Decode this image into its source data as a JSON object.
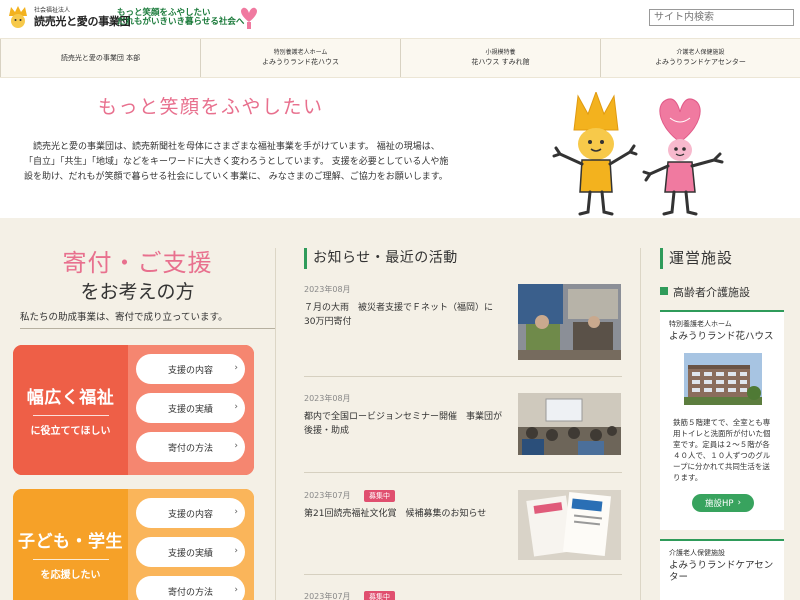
{
  "header": {
    "logo_sub": "社会福祉法人",
    "logo_main": "読売光と愛の事業団",
    "tagline_1": "もっと笑顔をふやしたい",
    "tagline_2": "だれもがいきいき暮らせる社会へ",
    "search_placeholder": "サイト内検索"
  },
  "nav": [
    {
      "sub": "",
      "label": "読売光と愛の事業団 本部"
    },
    {
      "sub": "特別養護老人ホーム",
      "label": "よみうりランド花ハウス"
    },
    {
      "sub": "小規模特養",
      "label": "花ハウス すみれ館"
    },
    {
      "sub": "介護老人保健施設",
      "label": "よみうりランドケアセンター"
    }
  ],
  "hero": {
    "title": "もっと笑顔をふやしたい",
    "text": "読売光と愛の事業団は、読売新聞社を母体にさまざまな福祉事業を手がけています。 福祉の現場は、「自立」「共生」「地域」などをキーワードに大きく変わろうとしています。 支援を必要としている人や施設を助け、だれもが笑顔で暮らせる社会にしていく事業に、 みなさまのご理解、ご協力をお願いします。"
  },
  "donate": {
    "title": "寄付・ご支援",
    "subtitle": "をお考えの方",
    "note": "私たちの助成事業は、寄付で成り立っています。",
    "cards": [
      {
        "big": "幅広く福祉",
        "small": "に役立ててほしい",
        "buttons": [
          "支援の内容",
          "支援の実績",
          "寄付の方法"
        ]
      },
      {
        "big": "子ども・学生",
        "small": "を応援したい",
        "buttons": [
          "支援の内容",
          "支援の実績",
          "寄付の方法"
        ]
      }
    ]
  },
  "news": {
    "heading": "お知らせ・最近の活動",
    "items": [
      {
        "date": "2023年08月",
        "badge": "",
        "text": "７月の大雨　被災者支援でＦネット（福岡）に30万円寄付"
      },
      {
        "date": "2023年08月",
        "badge": "",
        "text": "都内で全国ロービジョンセミナー開催　事業団が後援・助成"
      },
      {
        "date": "2023年07月",
        "badge": "募集中",
        "text": "第21回読売福祉文化賞　候補募集のお知らせ"
      },
      {
        "date": "2023年07月",
        "badge": "募集中",
        "text": ""
      }
    ]
  },
  "facilities": {
    "heading": "運営施設",
    "category": "高齢者介護施設",
    "cards": [
      {
        "label": "特別養護老人ホーム",
        "name": "よみうりランド花ハウス",
        "desc": "鉄筋５階建てで、全室とも専用トイレと洗面所が付いた個室です。定員は２～５階が各４０人で、１０人ずつのグループに分かれて共同生活を送ります。",
        "button": "施設HP"
      },
      {
        "label": "介護老人保健施設",
        "name": "よみうりランドケアセンター"
      }
    ]
  },
  "arrow_glyph": "›",
  "colors": {
    "brand_green": "#2f9b5a",
    "pink": "#e8708e",
    "red_card": "#ee5f47",
    "orange_card": "#f6a128"
  }
}
